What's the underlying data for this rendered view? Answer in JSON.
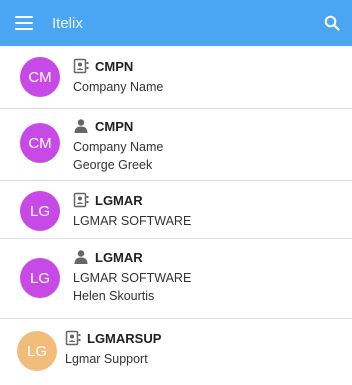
{
  "appbar": {
    "title": "Itelix"
  },
  "colors": {
    "appbar": "#4aa6f3",
    "avatar_purple": "#c84ae6",
    "avatar_orange": "#f2bd7b"
  },
  "items": [
    {
      "initials": "CM",
      "avatar_color": "#c84ae6",
      "icon": "contact-card-icon",
      "code": "CMPN",
      "company": "Company Name",
      "person": ""
    },
    {
      "initials": "CM",
      "avatar_color": "#c84ae6",
      "icon": "person-icon",
      "code": "CMPN",
      "company": "Company Name",
      "person": "George Greek"
    },
    {
      "initials": "LG",
      "avatar_color": "#c84ae6",
      "icon": "contact-card-icon",
      "code": "LGMAR",
      "company": "LGMAR SOFTWARE",
      "person": ""
    },
    {
      "initials": "LG",
      "avatar_color": "#c84ae6",
      "icon": "person-icon",
      "code": "LGMAR",
      "company": "LGMAR SOFTWARE",
      "person": "Helen Skourtis"
    },
    {
      "initials": "LG",
      "avatar_color": "#f2bd7b",
      "icon": "contact-card-icon",
      "code": "LGMARSUP",
      "company": "Lgmar Support",
      "person": ""
    }
  ]
}
